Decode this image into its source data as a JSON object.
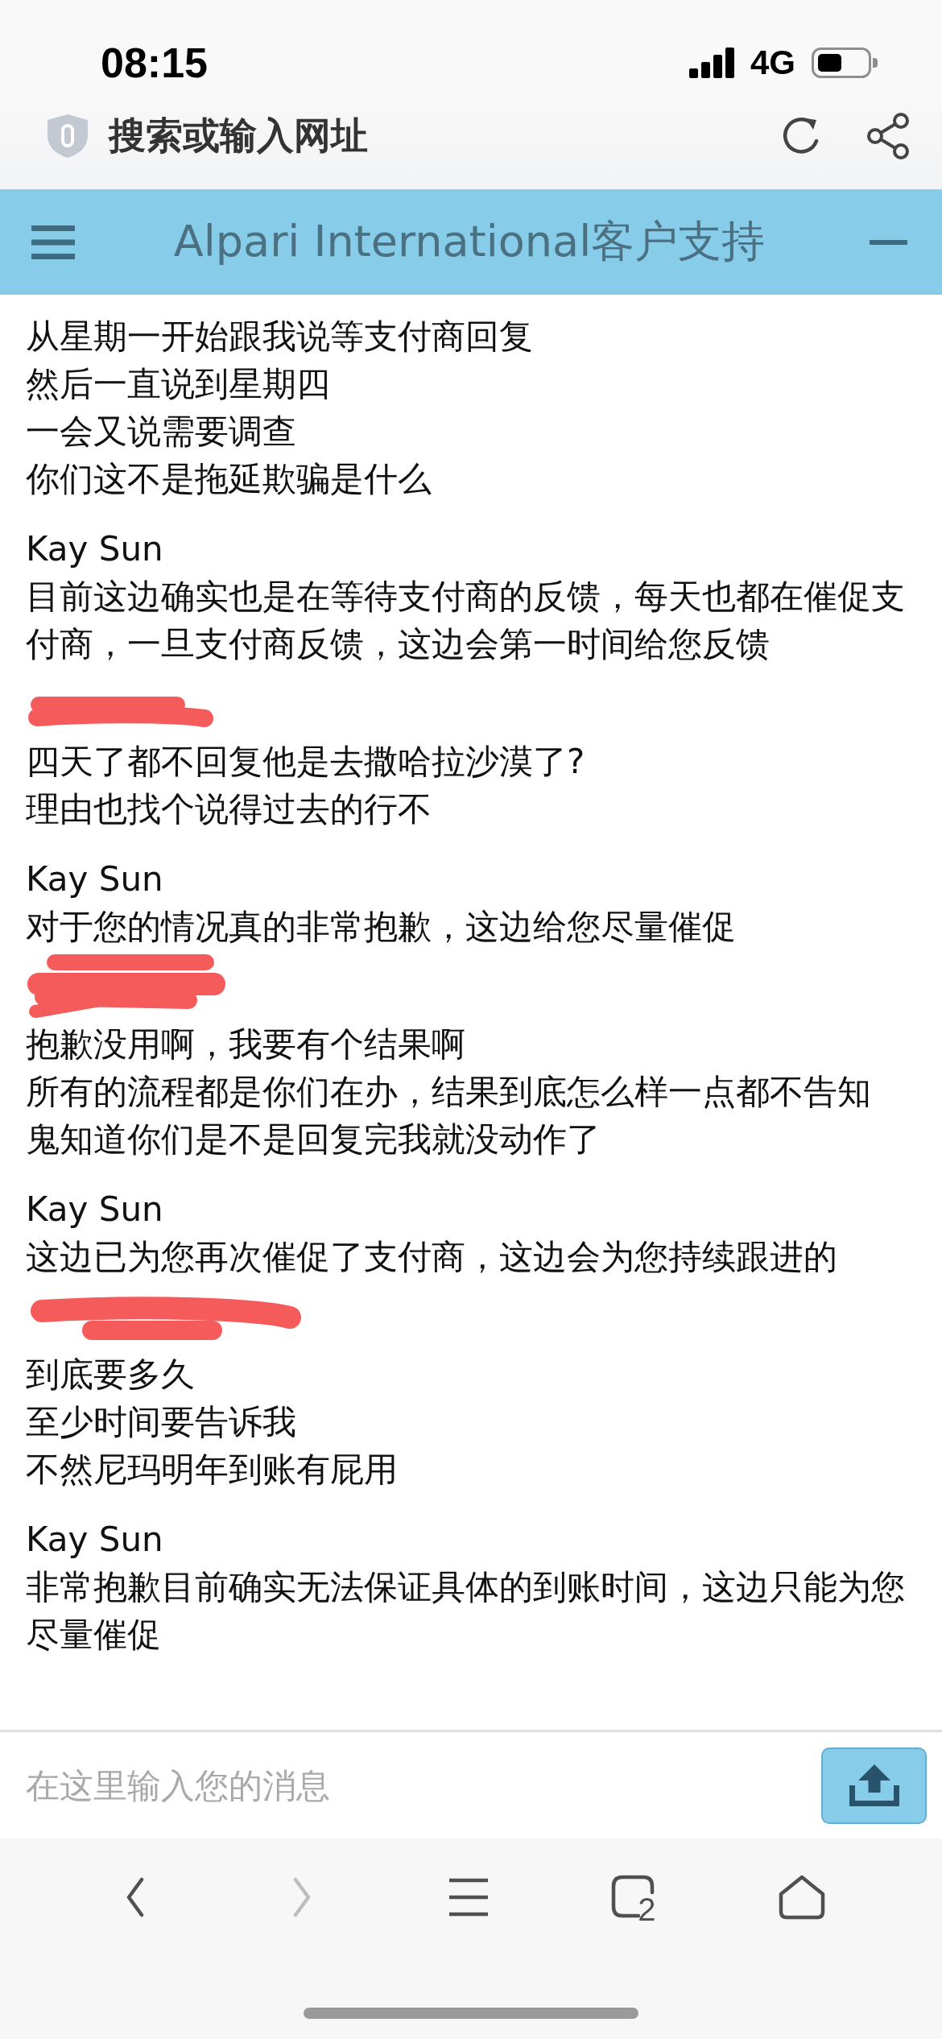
{
  "status_bar": {
    "time": "08:15",
    "network": "4G"
  },
  "address_bar": {
    "text": "搜索或输入网址"
  },
  "chat_header": {
    "title": "Alpari International客户支持"
  },
  "messages": [
    {
      "lines": [
        "从星期一开始跟我说等支付商回复",
        "然后一直说到星期四",
        "一会又说需要调查",
        "你们这不是拖延欺骗是什么"
      ]
    },
    {
      "sender": {
        "kind": "name",
        "text": "Kay Sun"
      },
      "lines": [
        "目前这边确实也是在等待支付商的反馈，每天也都在催促支付商，一旦支付商反馈，这边会第一时间给您反馈"
      ]
    },
    {
      "sender": {
        "kind": "redacted"
      },
      "lines": [
        "四天了都不回复他是去撒哈拉沙漠了?",
        "理由也找个说得过去的行不"
      ]
    },
    {
      "sender": {
        "kind": "name",
        "text": "Kay Sun"
      },
      "lines": [
        "对于您的情况真的非常抱歉，这边给您尽量催促"
      ]
    },
    {
      "sender": {
        "kind": "redacted"
      },
      "lines": [
        "抱歉没用啊，我要有个结果啊",
        "所有的流程都是你们在办，结果到底怎么样一点都不告知",
        "鬼知道你们是不是回复完我就没动作了"
      ]
    },
    {
      "sender": {
        "kind": "name",
        "text": "Kay Sun"
      },
      "lines": [
        "这边已为您再次催促了支付商，这边会为您持续跟进的"
      ]
    },
    {
      "sender": {
        "kind": "redacted"
      },
      "lines": [
        "到底要多久",
        "至少时间要告诉我",
        "不然尼玛明年到账有屁用"
      ]
    },
    {
      "sender": {
        "kind": "name",
        "text": "Kay Sun"
      },
      "lines": [
        "非常抱歉目前确实无法保证具体的到账时间，这边只能为您尽量催促"
      ]
    }
  ],
  "composer": {
    "placeholder": "在这里输入您的消息"
  },
  "toolbar": {
    "buttons": [
      {
        "kind": "back",
        "disabled": false
      },
      {
        "kind": "forward",
        "disabled": true
      },
      {
        "kind": "menu",
        "disabled": false
      },
      {
        "kind": "tabs",
        "disabled": false,
        "count": "2"
      },
      {
        "kind": "home",
        "disabled": false
      }
    ]
  }
}
